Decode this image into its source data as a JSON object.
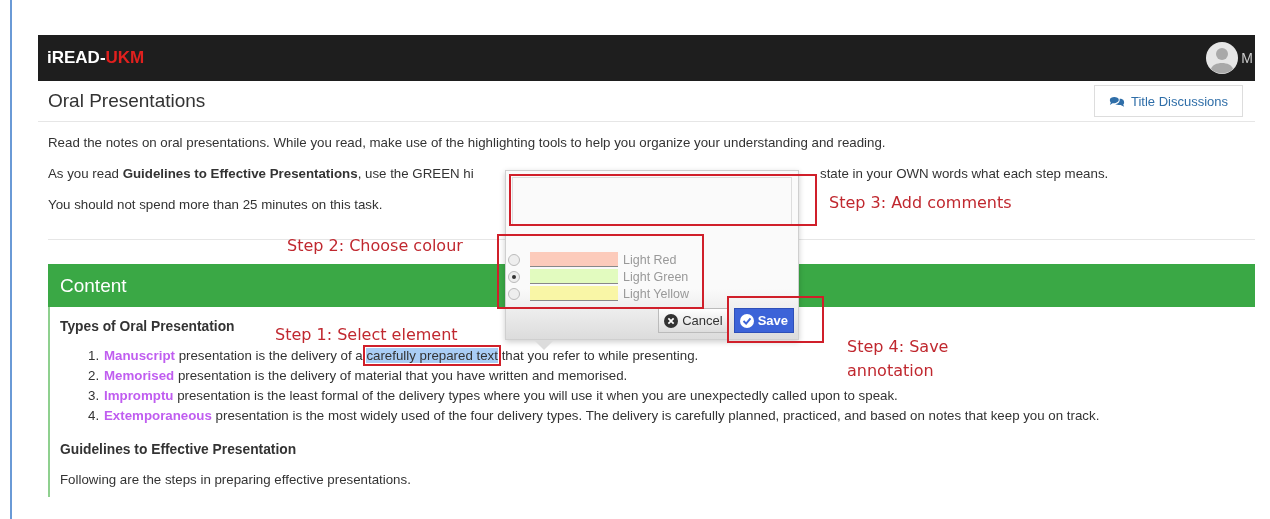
{
  "header": {
    "brand_prefix": "iREAD-",
    "brand_suffix": "UKM",
    "user": "M"
  },
  "page_title": "Oral Presentations",
  "discussions_button": "Title Discussions",
  "intro": [
    {
      "text": "Read the notes on oral presentations. While you read, make use of the highlighting tools to help you organize your understanding and reading."
    },
    {
      "text": "As you read **Guidelines to Effective Presentations**, use the GREEN hi",
      "continued": "state in your OWN words what each step means."
    },
    {
      "text": "You should not spend more than 25 minutes on this task."
    }
  ],
  "content": {
    "title": "Content",
    "heading": "Types of Oral Presentation",
    "items": [
      {
        "number": "1.",
        "term": "Manuscript",
        "text": " presentation is the delivery of a ",
        "highlight": "carefully prepared text",
        "rest": " that you refer to while presenting."
      },
      {
        "number": "2.",
        "term": "Memorised",
        "text": " presentation is the delivery of material that you have written and memorised."
      },
      {
        "number": "3.",
        "term": "Impromptu",
        "text": " presentation is the least formal of the delivery types where you will use it when you are unexpectedly called upon to speak."
      },
      {
        "number": "4.",
        "term": "Extemporaneous",
        "text": " presentation is the most widely used of the four delivery types. The delivery is carefully planned, practiced, and based on notes that keep you on track."
      }
    ],
    "heading_2": "Guidelines to Effective Presentation",
    "paragraph": "Following are the steps in preparing effective presentations."
  },
  "popup": {
    "colours": [
      {
        "label": "Light Red",
        "color": "#fccbbb",
        "selected": false
      },
      {
        "label": "Light Green",
        "color": "#e2fbbf",
        "selected": true
      },
      {
        "label": "Light Yellow",
        "color": "#f9f6a6",
        "selected": false
      }
    ],
    "cancel": "Cancel",
    "save": "Save"
  },
  "annotations": [
    {
      "kind": "step3",
      "text": "Step 3: Add comments"
    },
    {
      "kind": "step2",
      "text": "Step 2: Choose colour"
    },
    {
      "kind": "step1",
      "text": "Step 1: Select element"
    },
    {
      "kind": "step4",
      "text": "Step 4: Save annotation"
    }
  ]
}
